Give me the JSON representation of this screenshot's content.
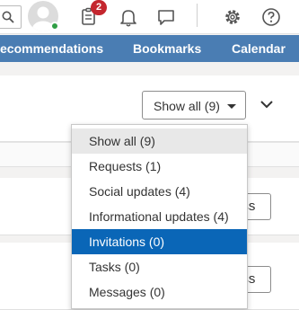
{
  "topbar": {
    "notification_count": "2",
    "icons": [
      "search-icon",
      "avatar",
      "clipboard-icon",
      "bell-icon",
      "chat-icon",
      "gear-icon",
      "help-icon"
    ]
  },
  "nav": {
    "items": [
      {
        "label": "ecommendations"
      },
      {
        "label": "Bookmarks"
      },
      {
        "label": "Calendar"
      }
    ]
  },
  "filter": {
    "button_label": "Show all (9)",
    "options": [
      {
        "label": "Show all (9)"
      },
      {
        "label": "Requests (1)"
      },
      {
        "label": "Social updates (4)"
      },
      {
        "label": "Informational updates (4)"
      },
      {
        "label": "Invitations (0)"
      },
      {
        "label": "Tasks (0)"
      },
      {
        "label": "Messages (0)"
      }
    ],
    "selected": "Invitations (0)"
  },
  "rows": [
    {
      "dismiss_label": "iss"
    },
    {
      "dismiss_label": "iss"
    }
  ],
  "colors": {
    "nav_bg": "#4a7db3",
    "highlight": "#0a66b7",
    "badge": "#c4262e",
    "presence": "#2f9e44"
  }
}
